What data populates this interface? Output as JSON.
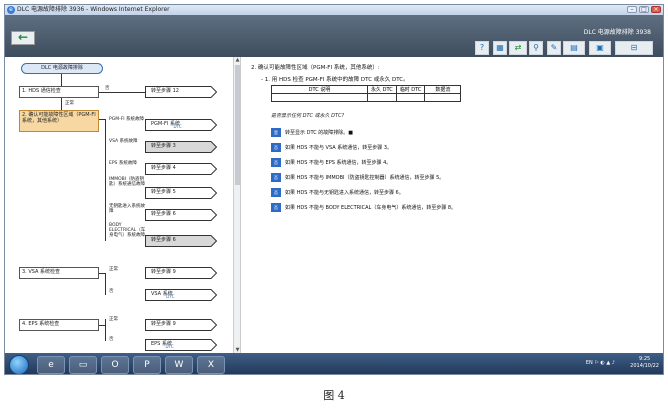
{
  "window": {
    "title": "DLC 电源故障排除 3936 - Windows Internet Explorer"
  },
  "toolbar": {
    "title": "DLC 电源故障排除 3938",
    "back_label": "←",
    "tools": [
      "?",
      "▦",
      "⇄",
      "⚲",
      "✎",
      "▤",
      "▣",
      "⊟"
    ]
  },
  "flow": {
    "start": "DLC 电源故障排除",
    "step1": "1. HDS 通信检查",
    "no_label": "否",
    "ok_label": "正常",
    "step1_goto": "转至步骤 12",
    "step2": "2. 确认可能故障性区域（PGM-FI 系统，其他系统）",
    "branches": [
      {
        "label": "PGM-FI 系统故障",
        "target": "PGM-FI 系统",
        "tag": "DTC"
      },
      {
        "label": "VSA 系统故障",
        "target": "转至步骤 3",
        "tag": ""
      },
      {
        "label": "EPS 系统故障",
        "target": "转至步骤 4",
        "tag": ""
      },
      {
        "label": "IMMOBI（防盗钥匙）系统通信故障",
        "target": "转至步骤 5",
        "tag": ""
      },
      {
        "label": "无钥匙进入系统故障",
        "target": "转至步骤 6",
        "tag": ""
      },
      {
        "label": "BODY ELECTRICAL（车身电气）系统故障",
        "target": "转至步骤 6",
        "tag": ""
      }
    ],
    "step3": "3. VSA 系统检查",
    "step3_ok": "正常",
    "step3_ok_goto": "转至步骤 9",
    "step3_no": "否",
    "step3_no_goto": "VSA 系统",
    "step4": "4. EPS 系统检查",
    "step4_ok": "正常",
    "step4_ok_goto": "转至步骤 9",
    "step4_no": "否",
    "step4_no_goto": "EPS 系统",
    "dtc_tag": "DTC"
  },
  "question": {
    "title": "2. 确认可能故障性区域（PGM-FI 系统，其他系统）:",
    "sub": "- 1. 用 HDS 检查 PGM-FI 系统中的故障 DTC 或永久 DTC。",
    "table_headers": [
      "DTC 说明",
      "永久 DTC",
      "临时 DTC",
      "数据流"
    ],
    "prompt": "是否显示任何 DTC 或永久 DTC?",
    "options": [
      {
        "badge": "是",
        "text": "转至显示 DTC 的故障排除。■"
      },
      {
        "badge": "否",
        "text": "如果 HDS 不能与 VSA 系统通信，转至步骤 3。"
      },
      {
        "badge": "否",
        "text": "如果 HDS 不能与 EPS 系统通信，转至步骤 4。"
      },
      {
        "badge": "否",
        "text": "如果 HDS 不能与 IMMOBI（防盗钥匙控制器）系统通信，转至步骤 5。"
      },
      {
        "badge": "否",
        "text": "如果 HDS 不能与无钥匙进入系统通信，转至步骤 6。"
      },
      {
        "badge": "否",
        "text": "如果 HDS 不能与 BODY ELECTRICAL（车身电气）系统通信，转至步骤 8。"
      }
    ]
  },
  "taskbar": {
    "apps": [
      "◉",
      "e",
      "▭",
      "O",
      "P",
      "W",
      "X"
    ],
    "tray": "EN  ⚐  ◐  ▲  ♪",
    "time": "9:25",
    "date": "2014/10/22"
  },
  "caption": "图 4"
}
